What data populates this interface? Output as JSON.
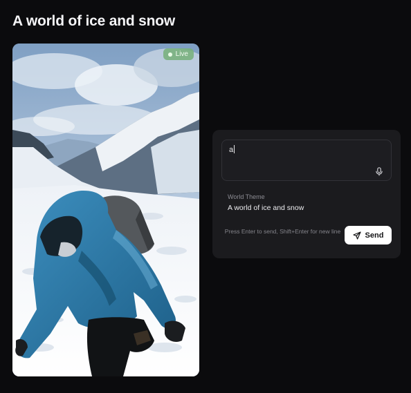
{
  "page": {
    "title": "A world of ice and snow"
  },
  "video": {
    "live_label": "Live",
    "scene": "skier-on-snowy-mountain",
    "live_color": "#78b07c"
  },
  "chat": {
    "prompt_value": "a",
    "mic_icon": "microphone-icon",
    "theme_label": "World Theme",
    "theme_value": "A world of ice and snow",
    "hint": "Press Enter to send, Shift+Enter for new line",
    "send_label": "Send",
    "send_icon": "paper-plane-icon"
  }
}
